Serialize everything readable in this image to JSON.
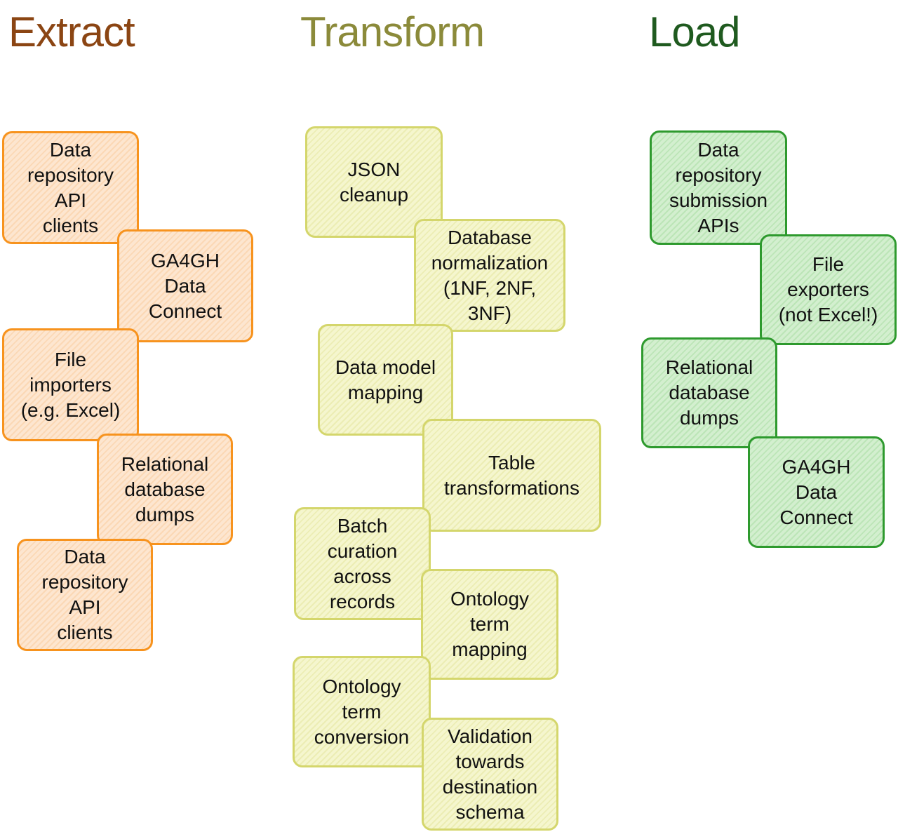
{
  "columns": [
    {
      "id": "extract",
      "heading": "Extract",
      "heading_color": "#8B4513",
      "border_color": "#F7931E",
      "items": [
        "Data\nrepository\nAPI\nclients",
        "GA4GH\nData\nConnect",
        "File\nimporters\n(e.g. Excel)",
        "Relational\ndatabase\ndumps",
        "Data\nrepository\nAPI\nclients"
      ]
    },
    {
      "id": "transform",
      "heading": "Transform",
      "heading_color": "#8B8A3A",
      "border_color": "#D4D66C",
      "items": [
        "JSON\ncleanup",
        "Database\nnormalization\n(1NF, 2NF,\n3NF)",
        "Data model\nmapping",
        "Table\ntransformations",
        "Batch\ncuration\nacross\nrecords",
        "Ontology\nterm\nmapping",
        "Ontology\nterm\nconversion",
        "Validation\ntowards\ndestination\nschema"
      ]
    },
    {
      "id": "load",
      "heading": "Load",
      "heading_color": "#1F5A1F",
      "border_color": "#2E9A2E",
      "items": [
        "Data\nrepository\nsubmission\nAPIs",
        "File\nexporters\n(not Excel!)",
        "Relational\ndatabase\ndumps",
        "GA4GH\nData\nConnect"
      ]
    }
  ]
}
